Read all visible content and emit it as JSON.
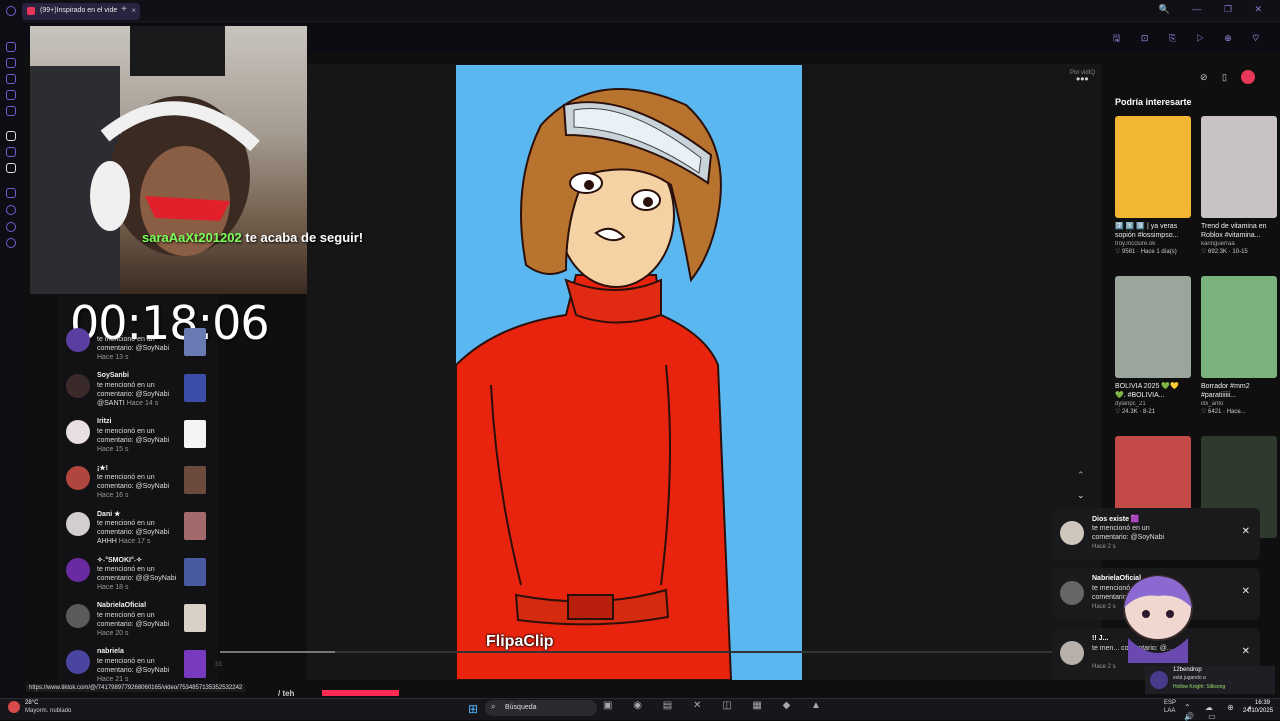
{
  "browser": {
    "tab_title": "(99+)Inspirado en el vide",
    "tab_close": "×",
    "new_tab": "+",
    "window_controls": "🔍 — ❐ ✕",
    "toolbar_icons": "🖫 ⊡ ⎘ ▷ ⊕ ♡"
  },
  "stream_overlay": {
    "follower": "saraAaXt201202",
    "follow_text": " te acaba de seguir!",
    "timer": "00:18:06"
  },
  "notifications": [
    {
      "name": "",
      "text": "te mencionó en un comentario: @SoyNabi",
      "time": "Hace 13 s",
      "avatar_color": "#5b3fa0",
      "thumb_color": "#6a7ab2"
    },
    {
      "name": "SoySanbi",
      "text": "te mencionó en un comentario: @SoyNabi @SANTI",
      "time": "Hace 14 s",
      "avatar_color": "#3a2a2a",
      "thumb_color": "#3a4ea8"
    },
    {
      "name": "Iritzi",
      "text": "te mencionó en un comentario: @SoyNabi",
      "time": "Hace 15 s",
      "avatar_color": "#e8dfe4",
      "thumb_color": "#f4f4f4"
    },
    {
      "name": "¡★!",
      "text": "te mencionó en un comentario: @SoyNabi",
      "time": "Hace 16 s",
      "avatar_color": "#b0463e",
      "thumb_color": "#6b4a3c"
    },
    {
      "name": "Dani ★",
      "text": "te mencionó en un comentario: @SoyNabi AHHH",
      "time": "Hace 17 s",
      "avatar_color": "#d2cdd0",
      "thumb_color": "#a36a6e"
    },
    {
      "name": "✧˖°SMOKI°˖✧",
      "text": "te mencionó en un comentario: @@SoyNabi",
      "time": "Hace 18 s",
      "avatar_color": "#6a2aa0",
      "thumb_color": "#4a5aa0"
    },
    {
      "name": "NabrielaOficial",
      "text": "te mencionó en un comentario: @SoyNabi",
      "time": "Hace 20 s",
      "avatar_color": "#5a5a5a",
      "thumb_color": "#d9d0c6"
    },
    {
      "name": "nabriela",
      "text": "te mencionó en un comentario: @SoyNabi",
      "time": "Hace 21 s",
      "avatar_color": "#4a46a0",
      "thumb_color": "#7a3ac0"
    }
  ],
  "player": {
    "por": "Por vidIQ",
    "more": "•••",
    "up": "⌃",
    "down": "⌄",
    "watermark": "FlipaClip",
    "left_caption": "/ teh",
    "time_small": "33"
  },
  "right_column": {
    "title": "Podría interesarte",
    "top_icons": "⊘ ▯",
    "cards": [
      {
        "caption": "7️⃣ 1️⃣ 3️⃣ | ya veras sopión #lossimpso...",
        "author": "troy.mcclure.ok",
        "stats": "♡ 9561 · Hace 1 día(s)",
        "color": "#f2b632"
      },
      {
        "caption": "Trend de vitamina en Roblox #vitamina...",
        "author": "karinguerraa",
        "stats": "♡ 692.3K · 10-15",
        "color": "#c8c2c4"
      },
      {
        "caption": "BOLIVIA 2025 💚💛 💚. #BOLIVIA...",
        "author": "dylanpc_21",
        "stats": "♡ 24.3K · 8-21",
        "color": "#9aa59c"
      },
      {
        "caption": "Borrador #mm2 #paratiiiiii...",
        "author": "iitx_anto",
        "stats": "♡ 6421 · Hace...",
        "color": "#7ab27c"
      },
      {
        "caption": "",
        "author": "",
        "stats": "",
        "color": "#c44a48"
      },
      {
        "caption": "",
        "author": "",
        "stats": "",
        "color": "#2e3a2e"
      }
    ]
  },
  "toasts": [
    {
      "name": "Dios existe 🟪",
      "text": "te mencionó en un comentario: @SoyNabi",
      "time": "Hace 2 s"
    },
    {
      "name": "NabrielaOficial",
      "text": "te mencionó en un comentario: ...",
      "time": "Hace 2 s"
    },
    {
      "name": "!! J...",
      "text": "te men... comentario: @...",
      "time": "Hace 2 s"
    }
  ],
  "toast_close": "✕",
  "twitch_popup": {
    "name": "12bendrop",
    "sub": "está jugando a",
    "game": "Hollow Knight: Silksong"
  },
  "status_url": "https://www.tiktok.com/@/7417989779268060165/video/7534857135352532242",
  "taskbar": {
    "weather_temp": "28°C",
    "weather_desc": "Mayorm. nublado",
    "start": "⊞",
    "search_icon": "⌕",
    "search": "Búsqueda",
    "apps": "▣ ◉ ▤ ✕ ◫ ▦ ◆ ▲",
    "lang1": "ESP",
    "lang2": "LAA",
    "tray": "⌃ ☁ ⊕ ◐ 🔊 ▭",
    "time": "16:39",
    "date": "24/10/2025"
  }
}
